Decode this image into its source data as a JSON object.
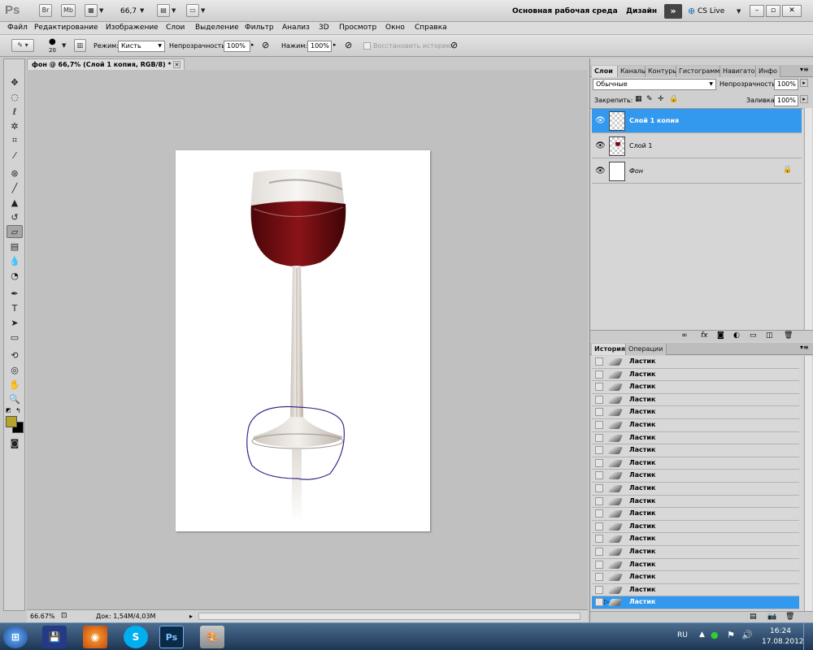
{
  "appbar": {
    "logo": "Ps",
    "btn_br": "Br",
    "btn_mb": "Mb",
    "zoom": "66,7",
    "workspace": "Основная рабочая среда",
    "design": "Дизайн",
    "cslive": "CS Live"
  },
  "menu": [
    "Файл",
    "Редактирование",
    "Изображение",
    "Слои",
    "Выделение",
    "Фильтр",
    "Анализ",
    "3D",
    "Просмотр",
    "Окно",
    "Справка"
  ],
  "options": {
    "brush_size": "20",
    "mode_label": "Режим:",
    "mode_value": "Кисть",
    "opacity_label": "Непрозрачность:",
    "opacity_value": "100%",
    "pressure_label": "Нажим:",
    "pressure_value": "100%",
    "restore_history": "Восстановить историю"
  },
  "document": {
    "tab_title": "фон @ 66,7% (Слой 1 копия, RGB/8) *",
    "zoom_status": "66.67%",
    "doc_info": "Док: 1,54М/4,03М"
  },
  "layers_panel": {
    "tabs": [
      "Слои",
      "Каналы",
      "Контуры",
      "Гистограмма",
      "Навигатор",
      "Инфо"
    ],
    "blend_mode": "Обычные",
    "opacity_label": "Непрозрачность:",
    "opacity_value": "100%",
    "lock_label": "Закрепить:",
    "fill_label": "Заливка:",
    "fill_value": "100%",
    "layers": [
      {
        "name": "Слой 1 копия",
        "active": true
      },
      {
        "name": "Слой 1",
        "active": false
      },
      {
        "name": "Фон",
        "active": false,
        "locked": true
      }
    ]
  },
  "history_panel": {
    "tabs": [
      "История",
      "Операции"
    ],
    "items": [
      "Ластик",
      "Ластик",
      "Ластик",
      "Ластик",
      "Ластик",
      "Ластик",
      "Ластик",
      "Ластик",
      "Ластик",
      "Ластик",
      "Ластик",
      "Ластик",
      "Ластик",
      "Ластик",
      "Ластик",
      "Ластик",
      "Ластик",
      "Ластик",
      "Ластик",
      "Ластик"
    ],
    "active_index": 19
  },
  "taskbar": {
    "lang": "RU",
    "time": "16:24",
    "date": "17.08.2012"
  },
  "colors": {
    "foreground": "#b8a42a",
    "background": "#000000",
    "selection": "#3399ee"
  }
}
